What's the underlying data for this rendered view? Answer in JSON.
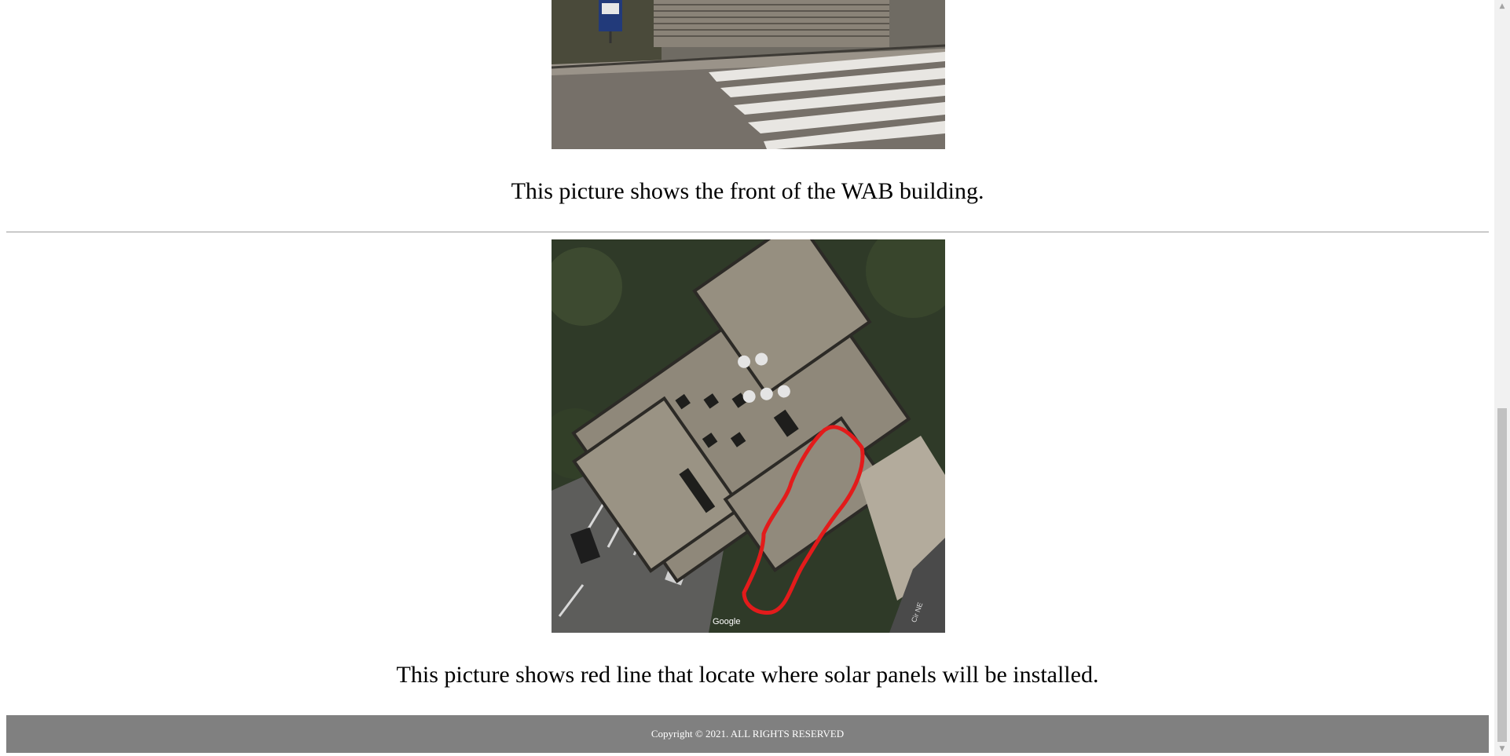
{
  "captions": {
    "front": "This picture shows the front of the WAB building.",
    "roof": "This picture shows red line that locate where solar panels will be installed."
  },
  "map_overlay": {
    "attribution": "Google",
    "street": "Cir NE"
  },
  "footer": {
    "copyright": "Copyright © 2021. ALL RIGHTS RESERVED"
  },
  "colors": {
    "footer_bg": "#808080",
    "outline_red": "#e31b1b"
  },
  "icons": {
    "scroll_up": "scroll-up-arrow-icon",
    "scroll_down": "scroll-down-arrow-icon"
  }
}
